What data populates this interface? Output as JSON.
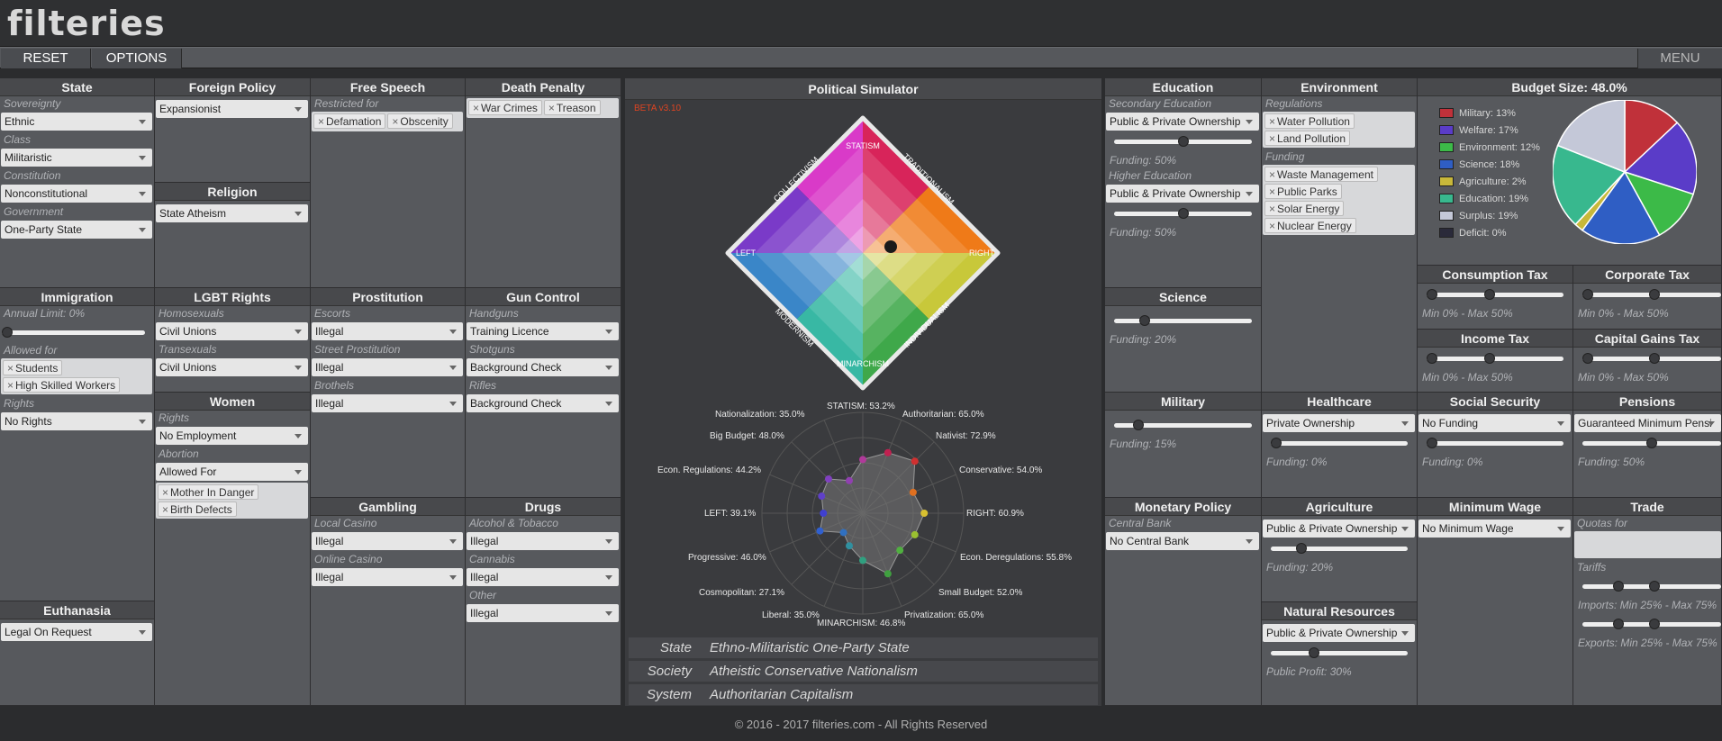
{
  "app": {
    "logo": "filteries",
    "reset": "RESET",
    "options": "OPTIONS",
    "menu": "MENU"
  },
  "footer": "© 2016 - 2017 filteries.com - All Rights Reserved",
  "state": {
    "title": "State",
    "sov_label": "Sovereignty",
    "sov": "Ethnic",
    "class_label": "Class",
    "class": "Militaristic",
    "const_label": "Constitution",
    "const": "Nonconstitutional",
    "gov_label": "Government",
    "gov": "One-Party State"
  },
  "foreign": {
    "title": "Foreign Policy",
    "value": "Expansionist"
  },
  "religion": {
    "title": "Religion",
    "value": "State Atheism"
  },
  "speech": {
    "title": "Free Speech",
    "restricted_label": "Restricted for",
    "tags": [
      "Defamation",
      "Obscenity"
    ]
  },
  "death": {
    "title": "Death Penalty",
    "tags": [
      "War Crimes",
      "Treason"
    ]
  },
  "immigration": {
    "title": "Immigration",
    "limit": "Annual Limit: 0%",
    "allowed_label": "Allowed for",
    "tags": [
      "Students",
      "High Skilled Workers"
    ],
    "rights_label": "Rights",
    "rights": "No Rights"
  },
  "lgbt": {
    "title": "LGBT Rights",
    "homo_label": "Homosexuals",
    "homo": "Civil Unions",
    "trans_label": "Transexuals",
    "trans": "Civil Unions"
  },
  "women": {
    "title": "Women",
    "rights_label": "Rights",
    "rights": "No Employment",
    "abortion_label": "Abortion",
    "abortion": "Allowed For",
    "tags": [
      "Mother In Danger",
      "Birth Defects"
    ]
  },
  "prostitution": {
    "title": "Prostitution",
    "escorts_label": "Escorts",
    "escorts": "Illegal",
    "street_label": "Street Prostitution",
    "street": "Illegal",
    "brothels_label": "Brothels",
    "brothels": "Illegal"
  },
  "guns": {
    "title": "Gun Control",
    "hand_label": "Handguns",
    "hand": "Training Licence",
    "shot_label": "Shotguns",
    "shot": "Background Check",
    "rifle_label": "Rifles",
    "rifle": "Background Check"
  },
  "gambling": {
    "title": "Gambling",
    "local_label": "Local Casino",
    "local": "Illegal",
    "online_label": "Online Casino",
    "online": "Illegal"
  },
  "drugs": {
    "title": "Drugs",
    "alc_label": "Alcohol & Tobacco",
    "alc": "Illegal",
    "can_label": "Cannabis",
    "can": "Illegal",
    "other_label": "Other",
    "other": "Illegal"
  },
  "euthanasia": {
    "title": "Euthanasia",
    "value": "Legal On Request"
  },
  "sim": {
    "title": "Political Simulator",
    "beta": "BETA v3.10",
    "axes": {
      "statism": "STATISM",
      "trad": "TRADITIONALISM",
      "right": "RIGHT",
      "indiv": "INDIVIDUALISM",
      "minarch": "MINARCHISM",
      "modern": "MODERNISM",
      "left": "LEFT",
      "collect": "COLLECTIVISM"
    },
    "radar": {
      "statism": "STATISM: 53.2%",
      "authoritarian": "Authoritarian: 65.0%",
      "nativist": "Nativist: 72.9%",
      "conservative": "Conservative: 54.0%",
      "right": "RIGHT: 60.9%",
      "deregulations": "Econ. Deregulations: 55.8%",
      "small_budget": "Small Budget: 52.0%",
      "privatization": "Privatization: 65.0%",
      "minarchism": "MINARCHISM: 46.8%",
      "liberal": "Liberal: 35.0%",
      "cosmopolitan": "Cosmopolitan: 27.1%",
      "progressive": "Progressive: 46.0%",
      "left": "LEFT: 39.1%",
      "regulations": "Econ. Regulations: 44.2%",
      "big_budget": "Big Budget: 48.0%",
      "nationalization": "Nationalization: 35.0%"
    },
    "results": [
      {
        "k": "State",
        "v": "Ethno-Militaristic One-Party State"
      },
      {
        "k": "Society",
        "v": "Atheistic Conservative Nationalism"
      },
      {
        "k": "System",
        "v": "Authoritarian Capitalism"
      }
    ]
  },
  "education": {
    "title": "Education",
    "sec_label": "Secondary Education",
    "sec": "Public & Private Ownership",
    "sec_fund": "Funding: 50%",
    "higher_label": "Higher Education",
    "higher": "Public & Private Ownership",
    "higher_fund": "Funding: 50%",
    "sec_level": 0.5,
    "higher_level": 0.5
  },
  "environment": {
    "title": "Environment",
    "reg_label": "Regulations",
    "reg_tags": [
      "Water Pollution",
      "Land Pollution"
    ],
    "fund_label": "Funding",
    "fund_tags": [
      "Waste Management",
      "Public Parks",
      "Solar Energy",
      "Nuclear Energy"
    ]
  },
  "budget": {
    "title": "Budget Size: 48.0%",
    "items": [
      {
        "label": "Military: 13%",
        "color": "#c0313a",
        "value": 13
      },
      {
        "label": "Welfare: 17%",
        "color": "#5a3cc8",
        "value": 17
      },
      {
        "label": "Environment: 12%",
        "color": "#3cba48",
        "value": 12
      },
      {
        "label": "Science: 18%",
        "color": "#2f5ec4",
        "value": 18
      },
      {
        "label": "Agriculture: 2%",
        "color": "#c8b83a",
        "value": 2
      },
      {
        "label": "Education: 19%",
        "color": "#38b88e",
        "value": 19
      },
      {
        "label": "Surplus: 19%",
        "color": "#c4c8d8",
        "value": 19
      },
      {
        "label": "Deficit: 0%",
        "color": "#2a2a3a",
        "value": 0
      }
    ]
  },
  "science": {
    "title": "Science",
    "fund": "Funding: 20%",
    "level": 0.2
  },
  "consumption": {
    "title": "Consumption Tax",
    "range": "Min 0% - Max 50%"
  },
  "corporate": {
    "title": "Corporate Tax",
    "range": "Min 0% - Max 50%"
  },
  "income": {
    "title": "Income Tax",
    "range": "Min 0% - Max 50%"
  },
  "capital": {
    "title": "Capital Gains Tax",
    "range": "Min 0% - Max 50%"
  },
  "military": {
    "title": "Military",
    "fund": "Funding: 15%",
    "level": 0.15
  },
  "healthcare": {
    "title": "Healthcare",
    "value": "Private Ownership",
    "fund": "Funding: 0%",
    "level": 0
  },
  "social": {
    "title": "Social Security",
    "value": "No Funding",
    "fund": "Funding: 0%",
    "level": 0
  },
  "pensions": {
    "title": "Pensions",
    "value": "Guaranteed Minimum Pensi",
    "fund": "Funding: 50%",
    "level": 0.5
  },
  "monetary": {
    "title": "Monetary Policy",
    "bank_label": "Central Bank",
    "bank": "No Central Bank"
  },
  "agriculture": {
    "title": "Agriculture",
    "value": "Public & Private Ownership",
    "fund": "Funding: 20%",
    "level": 0.2
  },
  "minwage": {
    "title": "Minimum Wage",
    "value": "No Minimum Wage"
  },
  "trade": {
    "title": "Trade",
    "quotas_label": "Quotas for",
    "tariffs_label": "Tariffs",
    "imports": "Imports: Min 25% - Max 75%",
    "exports": "Exports: Min 25% - Max 75%"
  },
  "natural": {
    "title": "Natural Resources",
    "value": "Public & Private Ownership",
    "profit": "Public Profit: 30%",
    "level": 0.3
  }
}
